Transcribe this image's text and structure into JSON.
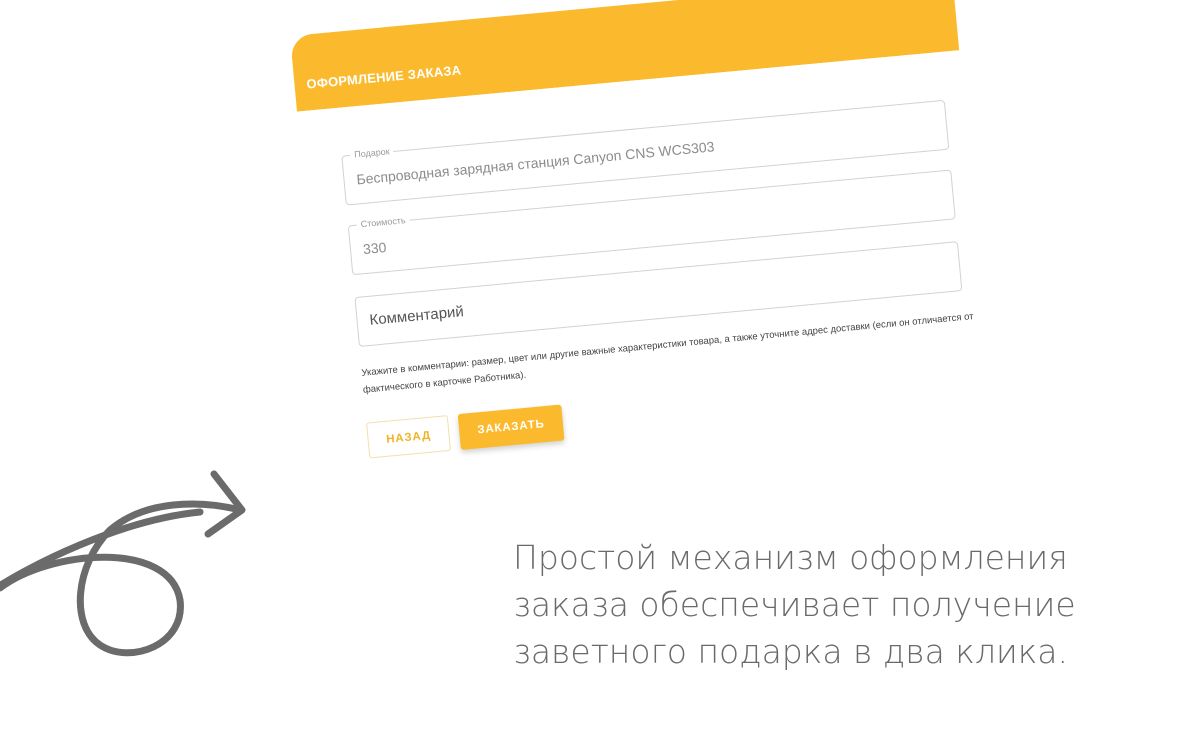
{
  "modal": {
    "title": "ОФОРМЛЕНИЕ ЗАКАЗА",
    "close_icon": "×",
    "fields": [
      {
        "label": "Подарок",
        "value": "Беспроводная зарядная станция Canyon CNS WCS303"
      },
      {
        "label": "Стоимость",
        "value": "330"
      },
      {
        "label": "",
        "placeholder": "Комментарий"
      }
    ],
    "hint": "Укажите в комментарии: размер, цвет или другие важные характеристики товара, а также уточните адрес доставки (если он отличается от фактического в карточке Работника).",
    "buttons": {
      "back_label": "НАЗАД",
      "order_label": "ЗАКАЗАТЬ"
    },
    "accent_color": "#fbba2e"
  },
  "tagline": {
    "line1": "Простой механизм оформления",
    "line2": "заказа обеспечивает получение",
    "line3": "заветного подарка в два клика."
  },
  "decor": {
    "arrow_icon": "curved-arrow-icon",
    "arrow_color": "#6b6b6b"
  }
}
